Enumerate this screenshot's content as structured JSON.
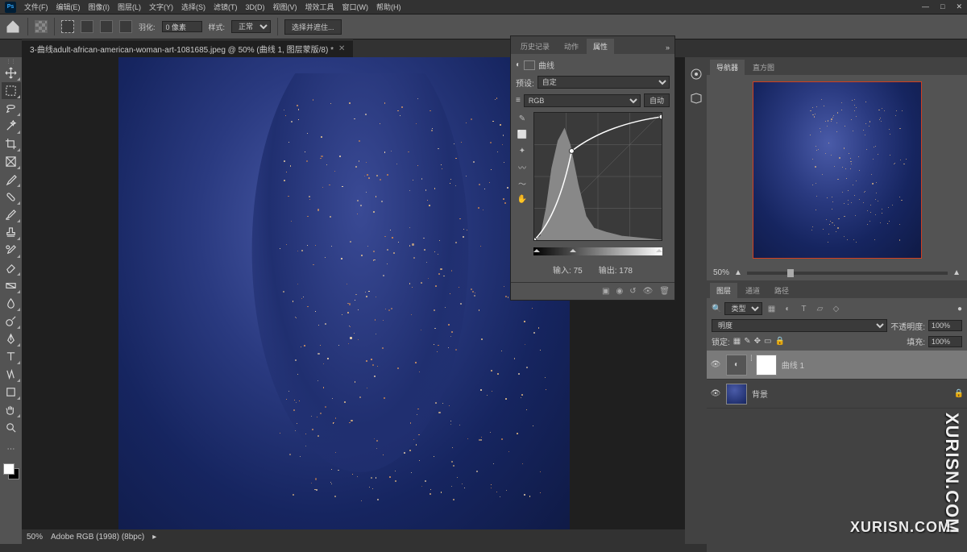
{
  "menu": {
    "items": [
      "文件(F)",
      "编辑(E)",
      "图像(I)",
      "图层(L)",
      "文字(Y)",
      "选择(S)",
      "滤镜(T)",
      "3D(D)",
      "视图(V)",
      "增效工具",
      "窗口(W)",
      "帮助(H)"
    ]
  },
  "optbar": {
    "feather_label": "羽化:",
    "feather_value": "0 像素",
    "style_label": "样式:",
    "style_value": "正常",
    "select_mask": "选择并遮住..."
  },
  "tab": {
    "title": "3-曲线adult-african-american-woman-art-1081685.jpeg @ 50% (曲线 1, 图层蒙版/8) *"
  },
  "status": {
    "zoom": "50%",
    "profile": "Adobe RGB (1998) (8bpc)"
  },
  "props": {
    "tabs": [
      "历史记录",
      "动作",
      "属性"
    ],
    "type_label": "曲线",
    "preset_label": "预设:",
    "preset_value": "自定",
    "channel": "RGB",
    "auto": "自动",
    "input_label": "输入:",
    "input_value": "75",
    "output_label": "输出:",
    "output_value": "178"
  },
  "nav": {
    "tabs": [
      "导航器",
      "直方图"
    ],
    "zoom": "50%"
  },
  "layers": {
    "tabs": [
      "图层",
      "通道",
      "路径"
    ],
    "filter_label": "类型",
    "blend": "明度",
    "opacity_label": "不透明度:",
    "opacity": "100%",
    "lock_label": "锁定:",
    "fill_label": "填充:",
    "fill": "100%",
    "items": [
      {
        "name": "曲线 1",
        "selected": true,
        "adj": true
      },
      {
        "name": "背景",
        "locked": true
      }
    ]
  },
  "watermark": "XURISN.COM"
}
